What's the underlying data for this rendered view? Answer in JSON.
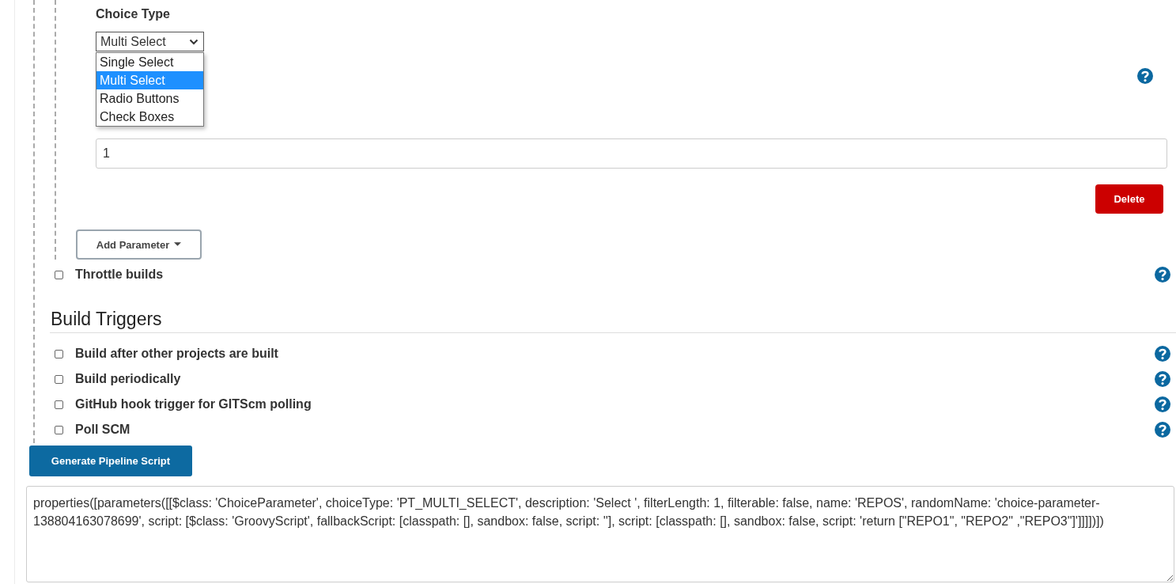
{
  "parameter": {
    "label": "Choice Type",
    "select": {
      "value": "Multi Select",
      "expanded": true,
      "options": [
        {
          "label": "Single Select",
          "selected": false
        },
        {
          "label": "Multi Select",
          "selected": true
        },
        {
          "label": "Radio Buttons",
          "selected": false
        },
        {
          "label": "Check Boxes",
          "selected": false
        }
      ]
    },
    "field": {
      "value": "1"
    },
    "delete_button": "Delete"
  },
  "add_parameter_button": "Add Parameter",
  "options": [
    {
      "label": "Throttle builds",
      "checked": false
    }
  ],
  "build_triggers": {
    "heading": "Build Triggers",
    "items": [
      {
        "label": "Build after other projects are built",
        "checked": false
      },
      {
        "label": "Build periodically",
        "checked": false
      },
      {
        "label": "GitHub hook trigger for GITScm polling",
        "checked": false
      },
      {
        "label": "Poll SCM",
        "checked": false
      }
    ]
  },
  "generate_button": "Generate Pipeline Script",
  "script_output": "properties([parameters([[$class: 'ChoiceParameter', choiceType: 'PT_MULTI_SELECT', description: 'Select ', filterLength: 1, filterable: false, name: 'REPOS', randomName: 'choice-parameter-138804163078699', script: [$class: 'GroovyScript', fallbackScript: [classpath: [], sandbox: false, script: ''], script: [classpath: [], sandbox: false, script: 'return [\"REPO1\", \"REPO2\" ,\"REPO3\"]']]]])])"
}
